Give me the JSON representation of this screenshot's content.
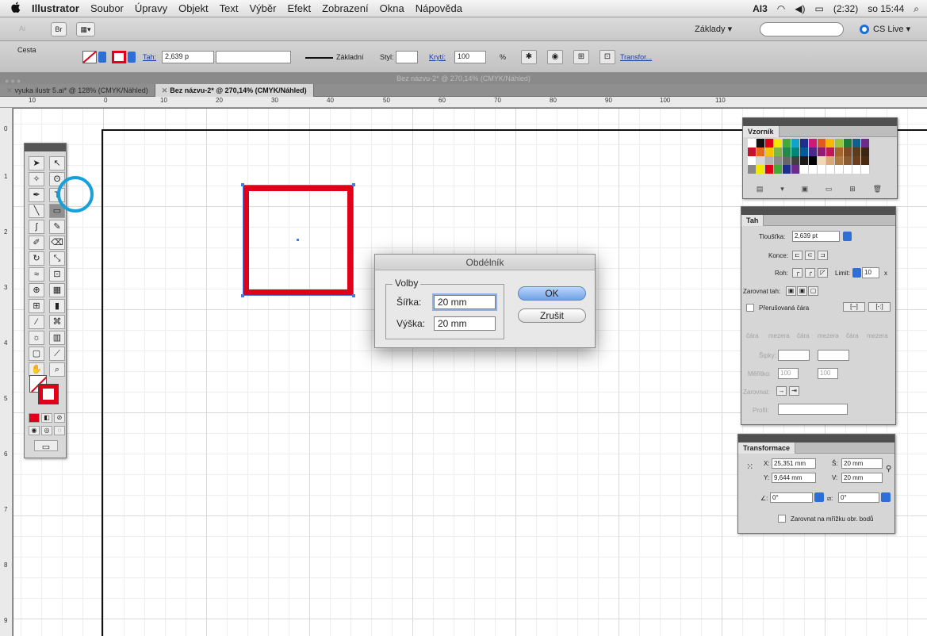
{
  "menubar": {
    "apple": "",
    "app": "Illustrator",
    "items": [
      "Soubor",
      "Úpravy",
      "Objekt",
      "Text",
      "Výběr",
      "Efekt",
      "Zobrazení",
      "Okna",
      "Nápověda"
    ],
    "status": [
      "3",
      "(2:32)",
      "so 15:44"
    ]
  },
  "appbar": {
    "br": "Br",
    "workspace": "Základy ▾",
    "cslive": "CS Live ▾"
  },
  "control": {
    "object_type": "Cesta",
    "stroke_label": "Tah:",
    "stroke_weight": "2,639 p",
    "profile": "Základní",
    "style_label": "Styl:",
    "opacity_label": "Krytí:",
    "opacity": "100",
    "percent": "%",
    "transform_link": "Transfor..."
  },
  "document": {
    "title": "Bez názvu-2* @ 270,14% (CMYK/Náhled)",
    "tabs": [
      {
        "label": "vyuka ilustr 5.ai* @ 128% (CMYK/Náhled)"
      },
      {
        "label": "Bez názvu-2* @ 270,14% (CMYK/Náhled)"
      }
    ]
  },
  "ruler": {
    "h": [
      "10",
      "0",
      "10",
      "20",
      "30",
      "40",
      "50",
      "60",
      "70",
      "80",
      "90",
      "100",
      "110"
    ],
    "v": [
      "0",
      "1",
      "2",
      "3",
      "4",
      "5",
      "6",
      "7",
      "8",
      "9"
    ]
  },
  "dialog": {
    "title": "Obdélník",
    "group": "Volby",
    "width_label": "Šířka:",
    "width_value": "20 mm",
    "height_label": "Výška:",
    "height_value": "20 mm",
    "ok": "OK",
    "cancel": "Zrušit"
  },
  "swatches": {
    "title": "Vzorník",
    "colors": [
      [
        "#ffffff",
        "#111111",
        "#e0001a",
        "#f4e800",
        "#45a93a",
        "#10a4c8",
        "#1d2f8c",
        "#d01878",
        "#e05a20",
        "#f7b800",
        "#9bc53d",
        "#1a7d3a",
        "#0f5f8f",
        "#6a2c86"
      ],
      [
        "#c8102e",
        "#e56a1b",
        "#f8c300",
        "#7ab648",
        "#1f8a4c",
        "#00867a",
        "#005b96",
        "#4a2a85",
        "#8f1d6b",
        "#ba1b54",
        "#a4672b",
        "#7a4b24",
        "#593b1d",
        "#3a2512"
      ],
      [
        "#ffffff",
        "#d7d7d7",
        "#b3b3b3",
        "#8c8c8c",
        "#666666",
        "#404040",
        "#1a1a1a",
        "#000000",
        "#f2d7b6",
        "#d8a878",
        "#b07a47",
        "#8a5a31",
        "#6a3f1f",
        "#4b2a13"
      ],
      [
        "#888888",
        "#f4e800",
        "#e0001a",
        "#45a93a",
        "#1d2f8c",
        "#6a2c86",
        "#ffffff",
        "#ffffff",
        "#ffffff",
        "#ffffff",
        "#ffffff",
        "#ffffff",
        "#ffffff",
        "#ffffff"
      ]
    ]
  },
  "stroke_panel": {
    "title": "Tah",
    "weight_label": "Tloušťka:",
    "weight": "2,639 pt",
    "cap_label": "Konce:",
    "corner_label": "Roh:",
    "limit_label": "Limit:",
    "limit": "10",
    "limit_unit": "x",
    "align_label": "Zarovnat tah:",
    "dashed_label": "Přerušovaná čára",
    "dash_labels": [
      "čára",
      "mezera",
      "čára",
      "mezera",
      "čára",
      "mezera"
    ],
    "arrows_label": "Šipky:",
    "scale_label": "Měřítko:",
    "scale_a": "100",
    "scale_b": "100",
    "align_arrows_label": "Zarovnat:",
    "profile_label": "Profil:"
  },
  "transform": {
    "title": "Transformace",
    "x_label": "X:",
    "x": "25,351 mm",
    "y_label": "Y:",
    "y": "9,644 mm",
    "w_label": "Š:",
    "w": "20 mm",
    "h_label": "V:",
    "h": "20 mm",
    "angle": "0°",
    "shear": "0°",
    "snap_label": "Zarovnat na mřížku obr. bodů"
  }
}
